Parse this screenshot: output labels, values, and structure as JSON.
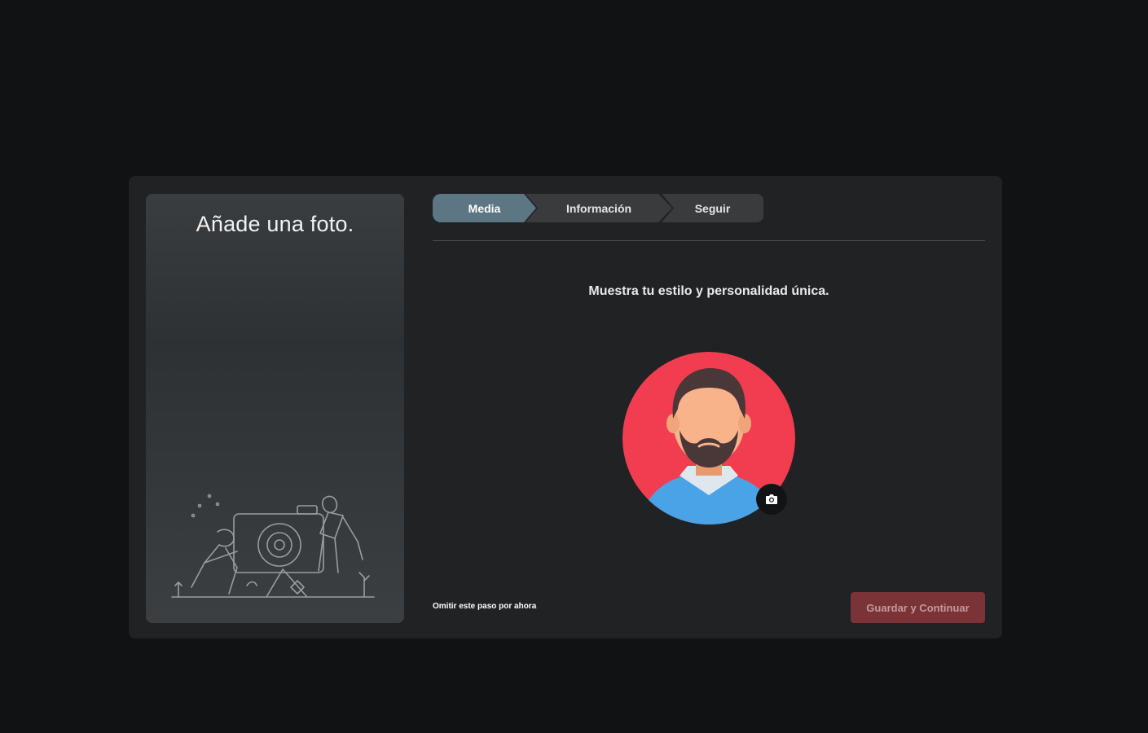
{
  "side_panel": {
    "title": "Añade una foto."
  },
  "steps": [
    {
      "label": "Media",
      "active": true
    },
    {
      "label": "Información",
      "active": false
    },
    {
      "label": "Seguir",
      "active": false
    }
  ],
  "main": {
    "subtitle": "Muestra tu estilo y personalidad única.",
    "skip_label": "Omitir este paso por ahora",
    "save_label": "Guardar y Continuar"
  },
  "icons": {
    "camera": "camera-icon",
    "avatar": "user-avatar"
  },
  "colors": {
    "background": "#111213",
    "modal": "#212223",
    "step_active": "#5d7684",
    "step_inactive": "#3a3b3c",
    "save_button": "#7a3336",
    "avatar_bg": "#f23d50",
    "avatar_shirt": "#4aa3e6"
  }
}
